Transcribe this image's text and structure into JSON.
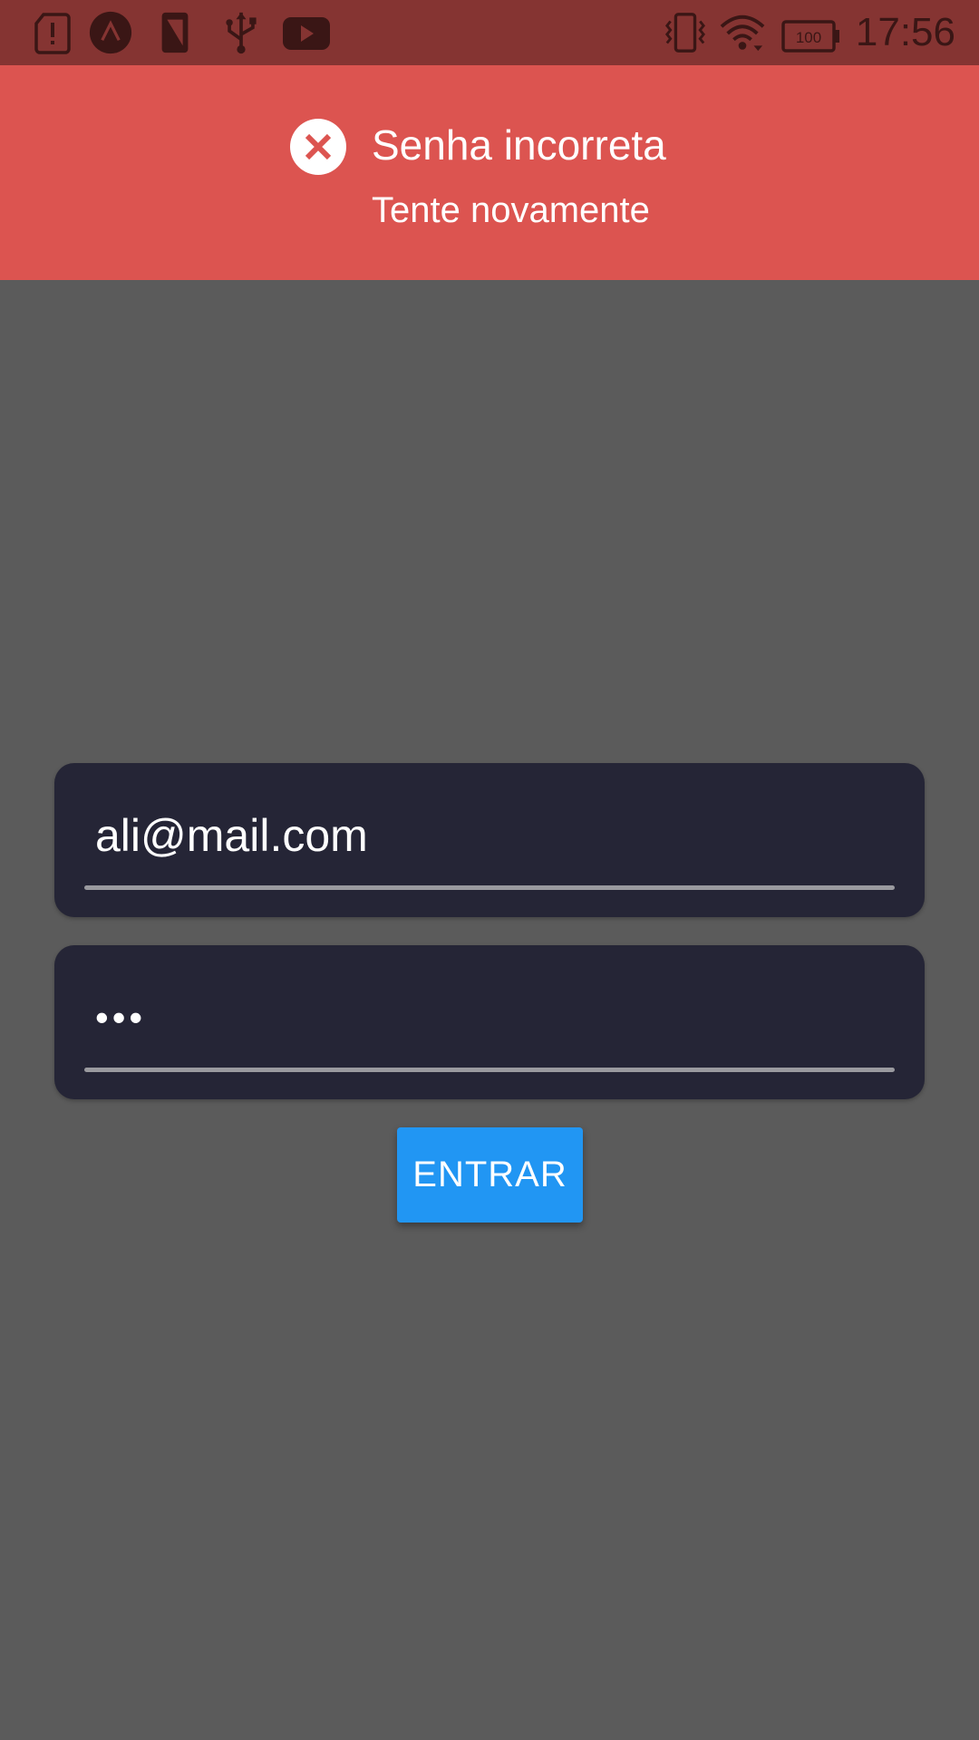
{
  "status_bar": {
    "time": "17:56",
    "battery_level": "100",
    "colors": {
      "background": "#853432",
      "icon": "#3a1615"
    },
    "left_icons": [
      "sd-card-alert-icon",
      "app-launcher-icon",
      "screen-rotation-icon",
      "usb-icon",
      "youtube-icon"
    ],
    "right_icons": [
      "vibrate-icon",
      "wifi-icon",
      "battery-icon"
    ]
  },
  "banner": {
    "title": "Senha incorreta",
    "subtitle": "Tente novamente",
    "icon": "error-x-icon",
    "color": "#dc5450"
  },
  "form": {
    "email_value": "ali@mail.com",
    "password_value": "•••",
    "submit_label": "ENTRAR",
    "field_color": "#252536",
    "button_color": "#2196f3"
  },
  "page": {
    "background": "#5b5b5b"
  }
}
